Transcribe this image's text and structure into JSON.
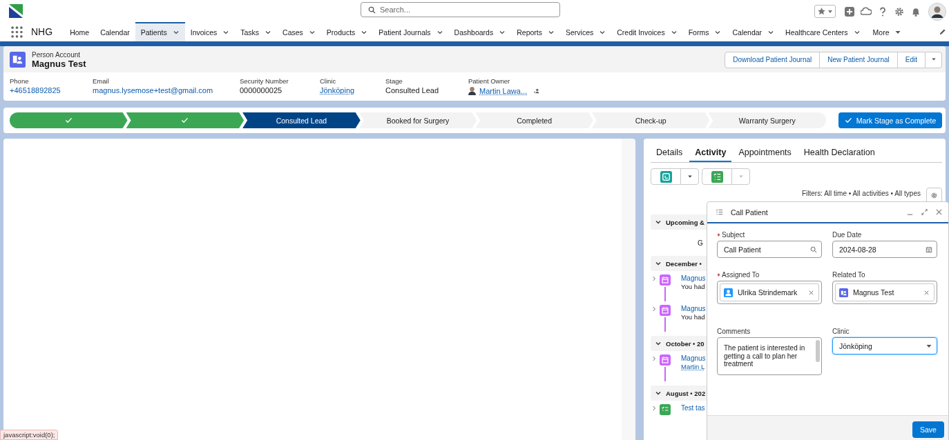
{
  "app": {
    "name": "NHG"
  },
  "search": {
    "placeholder": "Search..."
  },
  "nav": [
    {
      "label": "Home",
      "selected": false,
      "menu": false
    },
    {
      "label": "Calendar",
      "selected": false,
      "menu": false
    },
    {
      "label": "Patients",
      "selected": true,
      "menu": true
    },
    {
      "label": "Invoices",
      "selected": false,
      "menu": true
    },
    {
      "label": "Tasks",
      "selected": false,
      "menu": true
    },
    {
      "label": "Cases",
      "selected": false,
      "menu": true
    },
    {
      "label": "Products",
      "selected": false,
      "menu": true
    },
    {
      "label": "Patient Journals",
      "selected": false,
      "menu": true
    },
    {
      "label": "Dashboards",
      "selected": false,
      "menu": true
    },
    {
      "label": "Reports",
      "selected": false,
      "menu": true
    },
    {
      "label": "Services",
      "selected": false,
      "menu": true
    },
    {
      "label": "Credit Invoices",
      "selected": false,
      "menu": true
    },
    {
      "label": "Forms",
      "selected": false,
      "menu": true
    },
    {
      "label": "Calendar",
      "selected": false,
      "menu": true
    },
    {
      "label": "Healthcare Centers",
      "selected": false,
      "menu": true
    }
  ],
  "more": "More",
  "record": {
    "type": "Person Account",
    "name": "Magnus Test",
    "actions": [
      "Download Patient Journal",
      "New Patient Journal",
      "Edit"
    ],
    "fields": [
      {
        "label": "Phone",
        "value": "+46518892825",
        "kind": "link"
      },
      {
        "label": "Email",
        "value": "magnus.lysemose+test@gmail.com",
        "kind": "link"
      },
      {
        "label": "Security Number",
        "value": "0000000025",
        "kind": "text"
      },
      {
        "label": "Clinic",
        "value": "Jönköping",
        "kind": "lookup"
      },
      {
        "label": "Stage",
        "value": "Consulted Lead",
        "kind": "text"
      },
      {
        "label": "Patient Owner",
        "value": "Martin Lawa...",
        "kind": "owner"
      }
    ]
  },
  "path": {
    "stages": [
      {
        "completed": true,
        "selected": false
      },
      {
        "completed": true,
        "selected": false
      },
      {
        "label": "Consulted Lead",
        "completed": false,
        "selected": true
      },
      {
        "label": "Booked for Surgery",
        "completed": false,
        "selected": false
      },
      {
        "label": "Completed",
        "completed": false,
        "selected": false
      },
      {
        "label": "Check-up",
        "completed": false,
        "selected": false
      },
      {
        "label": "Warranty Surgery",
        "completed": false,
        "selected": false
      }
    ],
    "action": "Mark Stage as Complete"
  },
  "tabs": [
    {
      "label": "Details",
      "selected": false
    },
    {
      "label": "Activity",
      "selected": true
    },
    {
      "label": "Appointments",
      "selected": false
    },
    {
      "label": "Health Declaration",
      "selected": false
    }
  ],
  "filters": "Filters: All time • All activities • All types",
  "timeline": [
    {
      "kind": "section",
      "label": "Upcoming &"
    },
    {
      "kind": "note",
      "label": "G"
    },
    {
      "kind": "section",
      "label": "December •"
    },
    {
      "kind": "event",
      "title": "Magnus",
      "detail": "You had"
    },
    {
      "kind": "event",
      "title": "Magnus",
      "detail": "You had"
    },
    {
      "kind": "section",
      "label": "October • 20"
    },
    {
      "kind": "event",
      "title": "Magnus",
      "link": "Martin L"
    },
    {
      "kind": "section",
      "label": "August • 202"
    },
    {
      "kind": "task",
      "title": "Test tas"
    }
  ],
  "composer": {
    "title": "Call Patient",
    "fields": [
      {
        "label": "Subject",
        "required": true,
        "value": "Call Patient",
        "kind": "lookup"
      },
      {
        "label": "Due Date",
        "required": false,
        "value": "2024-08-28",
        "kind": "date"
      },
      {
        "label": "Assigned To",
        "required": true,
        "value": "Ulrika Strindemark",
        "kind": "user"
      },
      {
        "label": "Related To",
        "required": false,
        "value": "Magnus Test",
        "kind": "account"
      },
      {
        "label": "Comments",
        "required": false,
        "value": "The patient is interested in getting a call to plan her treatment",
        "kind": "textarea"
      },
      {
        "label": "Clinic",
        "required": false,
        "value": "Jönköping",
        "kind": "select"
      }
    ],
    "save": "Save"
  },
  "status_link": "javascript:void(0);"
}
